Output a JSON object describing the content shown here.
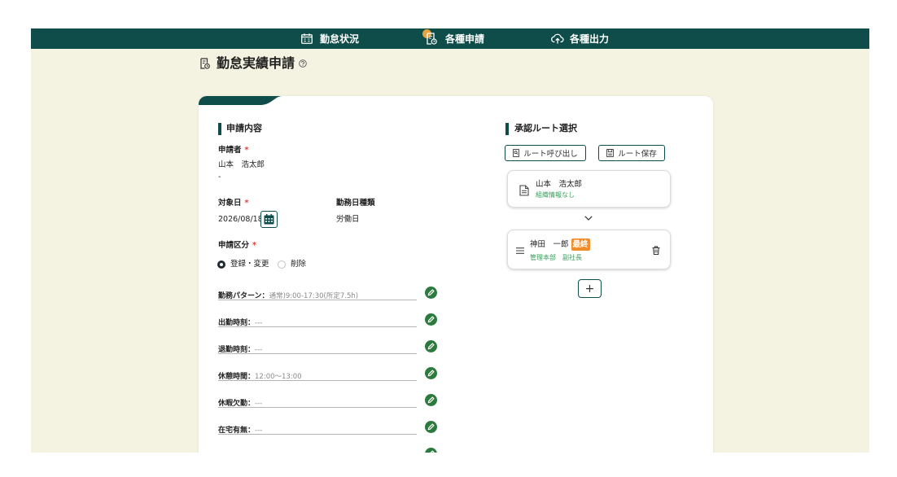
{
  "nav": {
    "items": [
      {
        "label": "勤怠状況",
        "icon": "calendar-check-icon"
      },
      {
        "label": "各種申請",
        "icon": "document-clock-icon"
      },
      {
        "label": "各種出力",
        "icon": "cloud-upload-icon"
      }
    ]
  },
  "page": {
    "title": "勤怠実績申請",
    "title_icon": "document-clock-icon",
    "help_icon": "help-circle-icon"
  },
  "form": {
    "section_title": "申請内容",
    "required_mark": "*",
    "applicant": {
      "label": "申請者",
      "name": "山本　浩太郎",
      "sub": "-"
    },
    "target_date": {
      "label": "対象日",
      "value": "2026/08/18",
      "icon": "calendar-icon"
    },
    "workday_type": {
      "label": "勤務日種類",
      "value": "労働日"
    },
    "category": {
      "label": "申請区分",
      "options": [
        {
          "label": "登録・変更",
          "checked": true
        },
        {
          "label": "削除",
          "checked": false
        }
      ]
    },
    "fields": [
      {
        "label": "勤務パターン：",
        "value": "通常)9:00-17:30(所定7.5h)"
      },
      {
        "label": "出勤時刻：",
        "value": "---"
      },
      {
        "label": "退勤時刻：",
        "value": "---"
      },
      {
        "label": "休憩時間：",
        "value": "12:00～13:00"
      },
      {
        "label": "休暇欠勤：",
        "value": "---"
      },
      {
        "label": "在宅有無：",
        "value": "---"
      }
    ],
    "edit_icon": "pencil-icon"
  },
  "route": {
    "section_title": "承認ルート選択",
    "load_button": {
      "label": "ルート呼び出し",
      "icon": "document-search-icon"
    },
    "save_button": {
      "label": "ルート保存",
      "icon": "save-icon"
    },
    "steps": [
      {
        "name": "山本　浩太郎",
        "org": "組織情報なし",
        "icon": "document-icon"
      },
      {
        "name": "神田　一郎",
        "badge": "最終",
        "org": "管理本部　副社長",
        "icon": "drag-handle-icon",
        "action_icon": "trash-icon"
      }
    ],
    "connector_icon": "chevron-down-icon",
    "add_button": {
      "label": "+"
    }
  },
  "colors": {
    "nav_bg": "#0e4d49",
    "page_bg": "#f4f2e1",
    "accent": "#0e4d49",
    "green_text": "#3c9d5d",
    "edit_icon": "#2d7a3e",
    "badge": "#f28c28",
    "nav_dot": "#e8a33d",
    "required": "#e53935"
  }
}
